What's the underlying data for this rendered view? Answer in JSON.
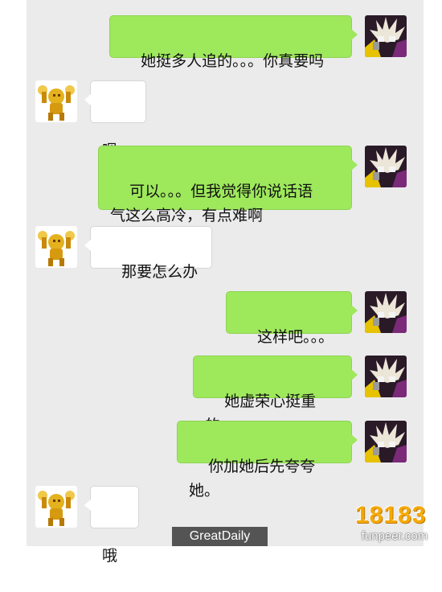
{
  "conversation": {
    "messages": [
      {
        "side": "right",
        "text": "她挺多人追的。。。你真要吗"
      },
      {
        "side": "left",
        "text": "嗯"
      },
      {
        "side": "right",
        "text": "可以。。。但我觉得你说话语\n气这么高冷，有点难啊"
      },
      {
        "side": "left",
        "text": "那要怎么办"
      },
      {
        "side": "right",
        "text": "这样吧。。。"
      },
      {
        "side": "right",
        "text": "她虚荣心挺重的。"
      },
      {
        "side": "right",
        "text": "你加她后先夸夸她。"
      },
      {
        "side": "left",
        "text": "哦"
      }
    ]
  },
  "avatars": {
    "me": "dark-anime-character-avatar",
    "friend": "golden-robot-avatar"
  },
  "colors": {
    "chat_background": "#ebebeb",
    "my_bubble": "#9ee85c",
    "friend_bubble": "#ffffff"
  },
  "watermark": {
    "label": "GreatDaily",
    "logo_number": "18183",
    "logo_site": "funpeer.com"
  }
}
